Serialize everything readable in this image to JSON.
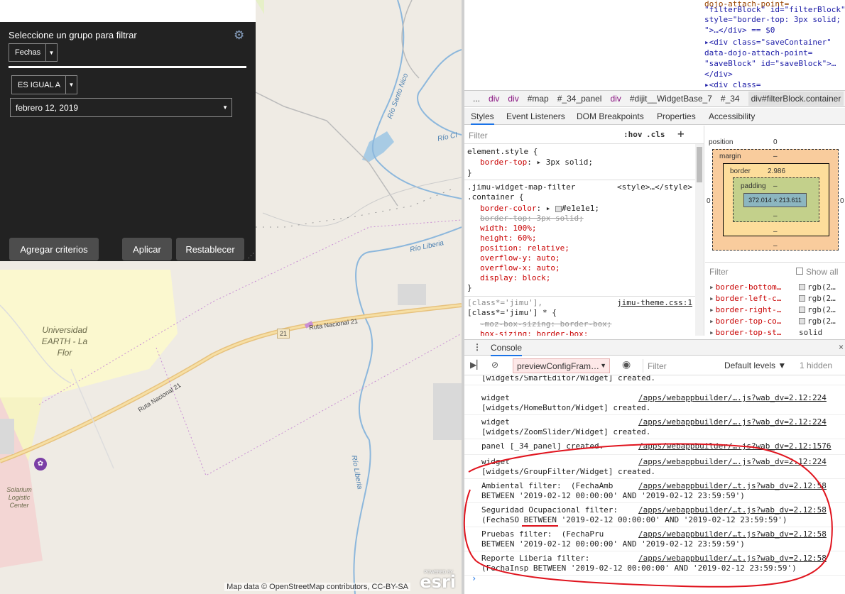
{
  "map": {
    "labels": {
      "university": "Universidad EARTH - La Flor",
      "solarium": "Solarium Logistic Center",
      "river_santo": "Río Santo Nico",
      "river_liberia_1": "Río Liberia",
      "river_liberia_2": "Río Liberia",
      "river_cl": "Río Cl",
      "road_1": "Ruta Nacional 21",
      "road_2": "Ruta Nacional 21",
      "road_shield": "21"
    },
    "attribution": "Map data © OpenStreetMap contributors, CC-BY-SA",
    "esri_powered": "POWERED BY",
    "esri_logo": "esri"
  },
  "filter_panel": {
    "title": "Seleccione un grupo para filtrar",
    "group_select": "Fechas",
    "operator_select": "ES IGUAL A",
    "date_value": "febrero 12, 2019",
    "buttons": {
      "add_criteria": "Agregar criterios",
      "apply": "Aplicar",
      "reset": "Restablecer"
    }
  },
  "devtools": {
    "dom_lines": [
      {
        "a": "\"filterBlock\" id=\"filterBlock\""
      },
      {
        "a": "style=\"border-top: 3px solid;"
      },
      {
        "a": "\">…</div> == $0"
      },
      {
        "a": "▸<div class=\"saveContainer\""
      },
      {
        "a": "data-dojo-attach-point="
      },
      {
        "a": "\"saveBlock\" id=\"saveBlock\">…"
      },
      {
        "a": "</div>"
      },
      {
        "a": "▸<div class="
      }
    ],
    "breadcrumbs": [
      "...",
      "div",
      "div",
      "#map",
      "#_34_panel",
      "div",
      "#dijit__WidgetBase_7",
      "#_34",
      "div#filterBlock.container"
    ],
    "tabs": [
      "Styles",
      "Event Listeners",
      "DOM Breakpoints",
      "Properties",
      "Accessibility"
    ],
    "styles_filter_placeholder": "Filter",
    "hov": ":hov",
    "cls": ".cls",
    "plus": "+",
    "css": {
      "element_style": "element.style {",
      "border_top_prop": "border-top",
      "border_top_val": "3px solid;",
      "close": "}",
      "rule2_sel1": ".jimu-widget-map-filter",
      "rule2_sel2": ".container {",
      "rule2_src": "<style>…</style>",
      "border_color_prop": "border-color",
      "border_color_val": "#e1e1e1;",
      "border_top2": "border-top: 3px solid;",
      "width": "width: 100%;",
      "height": "height: 60%;",
      "position": "position: relative;",
      "overflow_y": "overflow-y: auto;",
      "overflow_x": "overflow-x: auto;",
      "display": "display: block;",
      "rule3_sel1": "[class*='jimu'],",
      "rule3_sel2": "[class*='jimu'] * {",
      "rule3_src": "jimu-theme.css:1",
      "moz_box": "-moz-box-sizing: border-box;",
      "box_sizing": "box-sizing: border-box;"
    },
    "box_model": {
      "position_label": "position",
      "position_value": "0",
      "margin_label": "margin",
      "border_label": "border",
      "border_value": "2.986",
      "padding_label": "padding",
      "content": "372.014 × 213.611",
      "dash": "–",
      "zero": "0"
    },
    "computed": {
      "filter": "Filter",
      "show_all": "Show all",
      "rows": [
        {
          "name": "border-bottom…",
          "value": "rgb(2…"
        },
        {
          "name": "border-left-c…",
          "value": "rgb(2…"
        },
        {
          "name": "border-right-…",
          "value": "rgb(2…"
        },
        {
          "name": "border-top-co…",
          "value": "rgb(2…"
        },
        {
          "name": "border-top-st…",
          "value": "solid"
        }
      ]
    },
    "drawer": {
      "tab": "Console",
      "context": "previewConfigFram…",
      "filter": "Filter",
      "levels": "Default levels ▼",
      "hidden": "1 hidden"
    },
    "console": [
      {
        "text": "[widgets/SmartEditor/Widget] created.",
        "src": ""
      },
      {
        "text": "widget\n[widgets/HomeButton/Widget] created.",
        "src": "/apps/webappbuilder/….js?wab_dv=2.12:224"
      },
      {
        "text": "widget\n[widgets/ZoomSlider/Widget] created.",
        "src": "/apps/webappbuilder/….js?wab_dv=2.12:224"
      },
      {
        "text": "panel [_34_panel] created.",
        "src": "/apps/webappbuilder/….js?wab_dv=2.12:1576"
      },
      {
        "text": "widget\n[widgets/GroupFilter/Widget] created.",
        "src": "/apps/webappbuilder/….js?wab_dv=2.12:224"
      },
      {
        "text": "Ambiental filter:  (FechaAmb\nBETWEEN '2019-02-12 00:00:00' AND '2019-02-12 23:59:59')",
        "src": "/apps/webappbuilder/…t.js?wab_dv=2.12:58"
      },
      {
        "text": "Seguridad Ocupacional filter:\n(FechaSO BETWEEN '2019-02-12 00:00:00' AND '2019-02-12 23:59:59')",
        "src": "/apps/webappbuilder/…t.js?wab_dv=2.12:58"
      },
      {
        "text": "Pruebas filter:  (FechaPru\nBETWEEN '2019-02-12 00:00:00' AND '2019-02-12 23:59:59')",
        "src": "/apps/webappbuilder/…t.js?wab_dv=2.12:58"
      },
      {
        "text": "Reporte Liberia filter:\n(FechaInsp BETWEEN '2019-02-12 00:00:00' AND '2019-02-12 23:59:59')",
        "src": "/apps/webappbuilder/…t.js?wab_dv=2.12:58"
      }
    ],
    "prompt": "›"
  },
  "colors": {
    "panel_bg": "#222222",
    "button_bg": "#4d4d4d",
    "annotation_red": "#e0141e",
    "map_bg": "#efebe4"
  }
}
